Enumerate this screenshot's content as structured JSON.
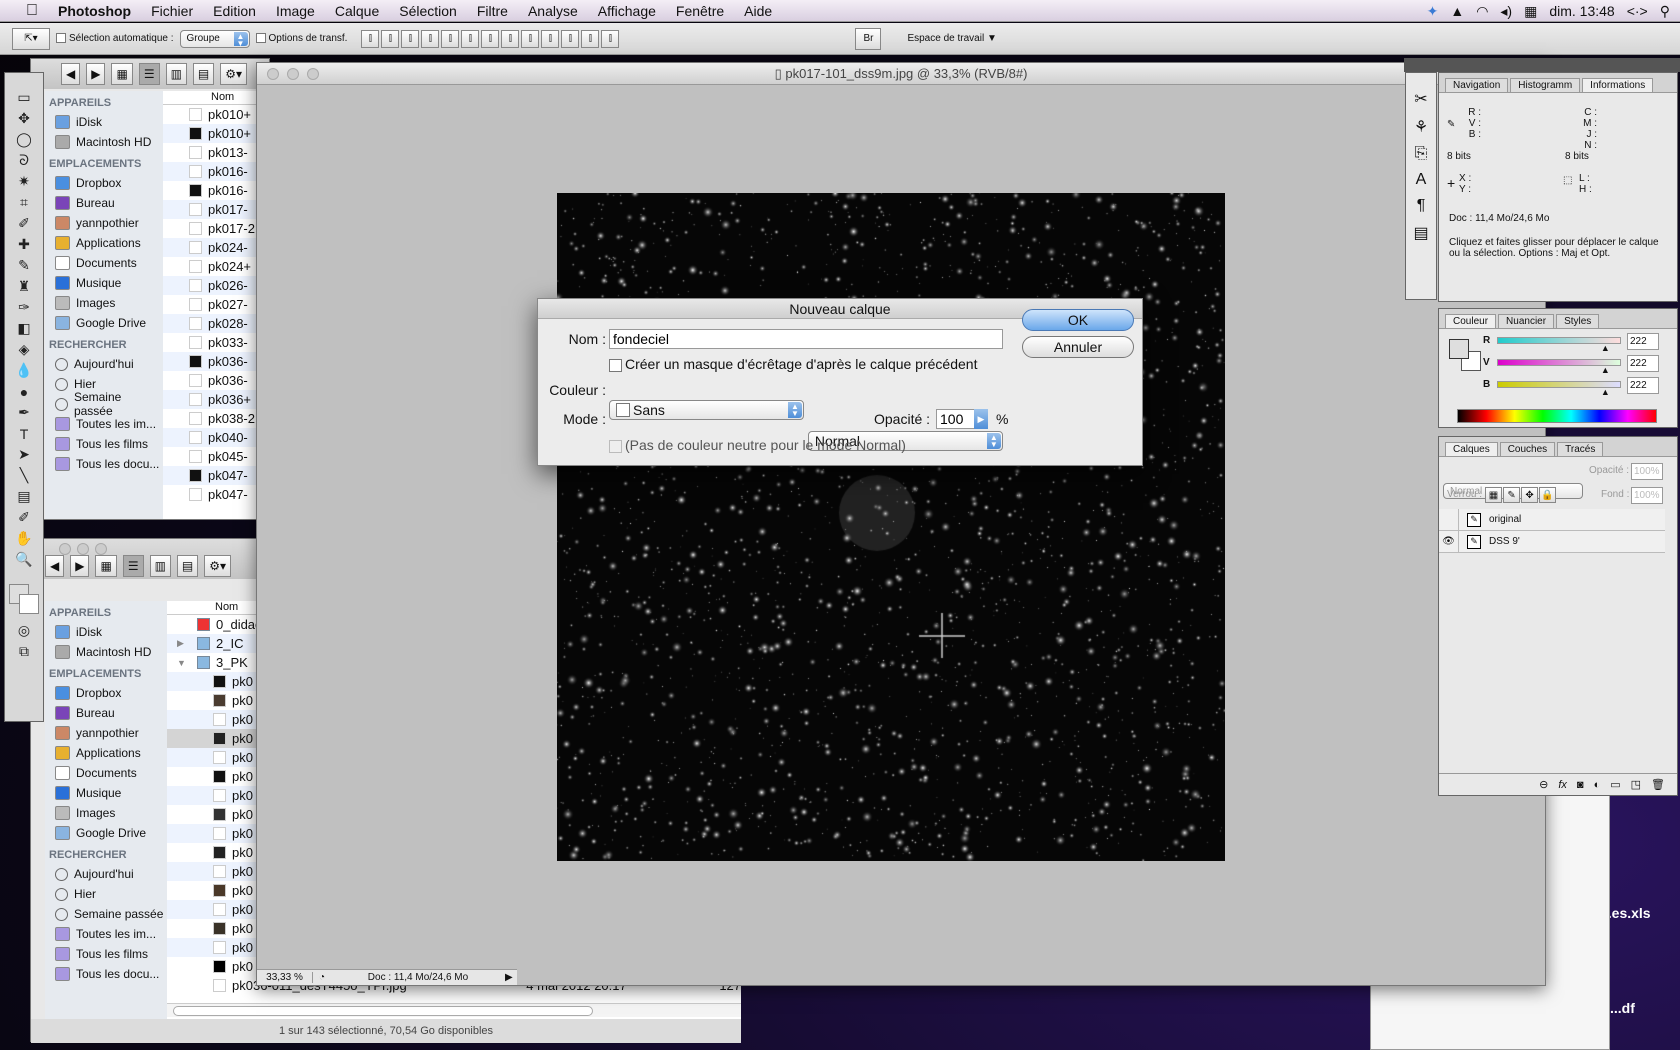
{
  "menubar": {
    "app": "Photoshop",
    "items": [
      "Fichier",
      "Edition",
      "Image",
      "Calque",
      "Sélection",
      "Filtre",
      "Analyse",
      "Affichage",
      "Fenêtre",
      "Aide"
    ],
    "clock": "dim. 13:48"
  },
  "options": {
    "auto_select": "Sélection automatique :",
    "auto_select_value": "Groupe",
    "transform": "Options de transf.",
    "workspace": "Espace de travail"
  },
  "finder_top": {
    "sections": [
      {
        "title": "APPAREILS",
        "items": [
          "iDisk",
          "Macintosh HD"
        ]
      },
      {
        "title": "EMPLACEMENTS",
        "items": [
          "Dropbox",
          "Bureau",
          "yannpothier",
          "Applications",
          "Documents",
          "Musique",
          "Images",
          "Google Drive"
        ]
      },
      {
        "title": "RECHERCHER",
        "items": [
          "Aujourd'hui",
          "Hier",
          "Semaine passée",
          "Toutes les im...",
          "Tous les films",
          "Tous les docu..."
        ]
      }
    ],
    "col_name": "Nom",
    "files": [
      "pk010+",
      "pk010+",
      "pk013-",
      "pk016-",
      "pk016-",
      "pk017-",
      "pk017-2",
      "pk024-",
      "pk024+",
      "pk026-",
      "pk027-",
      "pk028-",
      "pk033-",
      "pk036-",
      "pk036-",
      "pk036+",
      "pk038-2",
      "pk040-",
      "pk045-",
      "pk047-",
      "pk047-"
    ],
    "thumbs": [
      "#fff",
      "#111",
      "#fff",
      "#fff",
      "#111",
      "#fff",
      "#fff",
      "#fff",
      "#fff",
      "#fff",
      "#fff",
      "#fff",
      "#fff",
      "#111",
      "#fff",
      "#fff",
      "#fff",
      "#fff",
      "#fff",
      "#111",
      "#fff"
    ]
  },
  "finder_bottom": {
    "col_name": "Nom",
    "folders": [
      "0_didac",
      "2_IC",
      "3_PK"
    ],
    "files": [
      "pk0",
      "pk0",
      "pk0",
      "pk0",
      "pk0",
      "pk0",
      "pk0",
      "pk0",
      "pk0",
      "pk0",
      "pk0",
      "pk0",
      "pk0",
      "pk0",
      "pk0",
      "pk0"
    ],
    "thumbs": [
      "#111",
      "#4a3c30",
      "#fff",
      "#222",
      "#fff",
      "#111",
      "#fff",
      "#333",
      "#fff",
      "#222",
      "#fff",
      "#4a3828",
      "#fff",
      "#3a3228",
      "#fff",
      "#000"
    ],
    "last_file": {
      "name": "pk036-011_desT445o_YPr.jpg",
      "date": "4 mai 2012 20:17",
      "size": "127"
    },
    "status": "1 sur 143 sélectionné, 70,54 Go disponibles"
  },
  "document": {
    "title": "pk017-101_dss9m.jpg @ 33,3% (RVB/8#)",
    "zoom": "33,33 %",
    "doc_info": "Doc : 11,4 Mo/24,6 Mo"
  },
  "dialog": {
    "title": "Nouveau calque",
    "name_label": "Nom :",
    "name_value": "fondeciel",
    "clip_label": "Créer un masque d'écrêtage d'après le calque précédent",
    "color_label": "Couleur :",
    "color_value": "Sans",
    "mode_label": "Mode :",
    "mode_value": "Normal",
    "opacity_label": "Opacité :",
    "opacity_value": "100",
    "percent": "%",
    "neutral_label": "(Pas de couleur neutre pour le mode Normal)",
    "ok": "OK",
    "cancel": "Annuler"
  },
  "info_panel": {
    "tabs": [
      "Navigation",
      "Histogramm",
      "Informations"
    ],
    "rgb": [
      "R :",
      "V :",
      "B :"
    ],
    "cmyk": [
      "C :",
      "M :",
      "J :",
      "N :"
    ],
    "bits": "8 bits",
    "xy": [
      "X :",
      "Y :"
    ],
    "lh": [
      "L :",
      "H :"
    ],
    "doc": "Doc : 11,4 Mo/24,6 Mo",
    "hint": "Cliquez et faites glisser pour déplacer le calque ou la sélection. Options : Maj et Opt."
  },
  "color_panel": {
    "tabs": [
      "Couleur",
      "Nuancier",
      "Styles"
    ],
    "channels": [
      {
        "label": "R",
        "value": "222"
      },
      {
        "label": "V",
        "value": "222"
      },
      {
        "label": "B",
        "value": "222"
      }
    ],
    "fraction": 0.87
  },
  "layers_panel": {
    "tabs": [
      "Calques",
      "Couches",
      "Tracés"
    ],
    "blend": "Normal",
    "opacity_label": "Opacité :",
    "opacity": "100%",
    "lock_label": "Verrou :",
    "fill_label": "Fond :",
    "fill": "100%",
    "layers": [
      {
        "name": "original",
        "visible": false
      },
      {
        "name": "DSS 9'",
        "visible": true
      }
    ]
  },
  "desktop": {
    "files": [
      "...es.xls",
      "...df"
    ]
  }
}
